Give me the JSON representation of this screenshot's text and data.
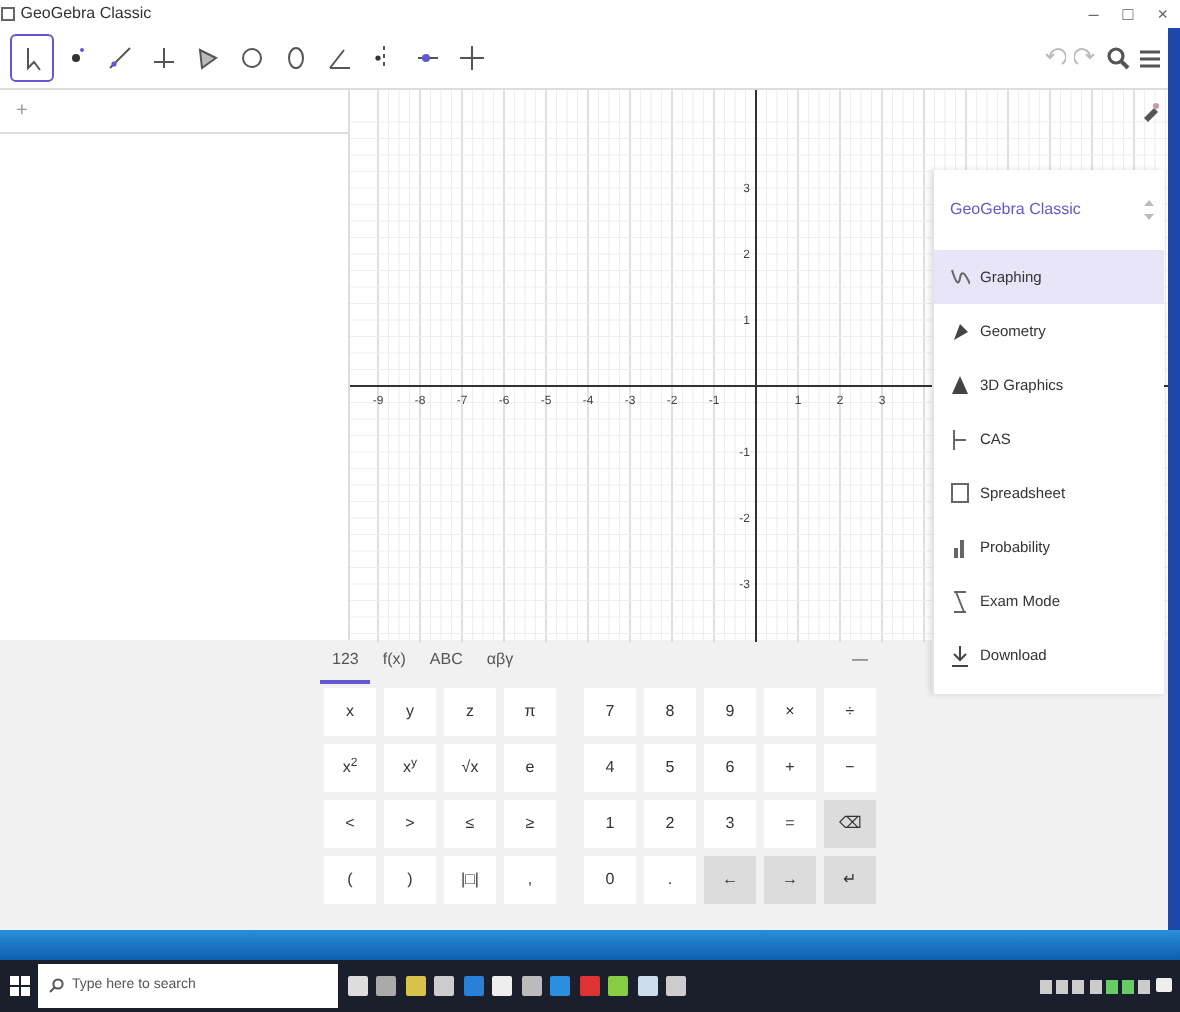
{
  "window": {
    "title": "GeoGebra Classic",
    "controls": [
      "–",
      "□",
      "×"
    ]
  },
  "toolbar": {
    "tools": [
      {
        "selected": true
      },
      {
        "selected": false
      },
      {
        "selected": false
      },
      {
        "selected": false
      },
      {
        "selected": false
      },
      {
        "selected": false
      },
      {
        "selected": false
      },
      {
        "selected": false
      },
      {
        "selected": false
      },
      {
        "selected": false
      },
      {
        "selected": false
      }
    ]
  },
  "algebra": {
    "input_mark": "+"
  },
  "graphics": {
    "x_labels": [
      "-9",
      "-8",
      "-7",
      "-6",
      "-5",
      "-4",
      "-3",
      "-2",
      "-1",
      "1",
      "2",
      "3"
    ],
    "y_labels_above": [
      "3",
      "2",
      "1"
    ],
    "y_labels_below": [
      "-1",
      "-2",
      "-3"
    ]
  },
  "menu": {
    "title": "GeoGebra Classic",
    "items": [
      {
        "label": "Graphing",
        "selected": true
      },
      {
        "label": "Geometry",
        "selected": false
      },
      {
        "label": "3D Graphics",
        "selected": false
      },
      {
        "label": "CAS",
        "selected": false
      },
      {
        "label": "Spreadsheet",
        "selected": false
      },
      {
        "label": "Probability",
        "selected": false
      },
      {
        "label": "Exam Mode",
        "selected": false
      },
      {
        "label": "Download",
        "selected": false
      }
    ]
  },
  "keyboard": {
    "tabs": [
      {
        "label": "123",
        "selected": true
      },
      {
        "label": "f(x)",
        "selected": false
      },
      {
        "label": "ABC",
        "selected": false
      },
      {
        "label": "αβγ",
        "selected": false
      }
    ],
    "close": "—",
    "rows": [
      [
        {
          "label": "x",
          "kind": "key"
        },
        {
          "label": "y",
          "kind": "key"
        },
        {
          "label": "z",
          "kind": "key"
        },
        {
          "label": "π",
          "kind": "key"
        },
        {
          "label": "7",
          "kind": "key"
        },
        {
          "label": "8",
          "kind": "key"
        },
        {
          "label": "9",
          "kind": "key"
        },
        {
          "label": "×",
          "kind": "key"
        },
        {
          "label": "÷",
          "kind": "key"
        }
      ],
      [
        {
          "label": "x$^{2}$",
          "kind": "key"
        },
        {
          "label": "x$^{y}$",
          "kind": "key"
        },
        {
          "label": "√x",
          "kind": "key"
        },
        {
          "label": "e",
          "kind": "key"
        },
        {
          "label": "4",
          "kind": "key"
        },
        {
          "label": "5",
          "kind": "key"
        },
        {
          "label": "6",
          "kind": "key"
        },
        {
          "label": "+",
          "kind": "key"
        },
        {
          "label": "−",
          "kind": "key"
        }
      ],
      [
        {
          "label": "<",
          "kind": "key"
        },
        {
          "label": ">",
          "kind": "key"
        },
        {
          "label": "≤",
          "kind": "key"
        },
        {
          "label": "≥",
          "kind": "key"
        },
        {
          "label": "1",
          "kind": "key"
        },
        {
          "label": "2",
          "kind": "key"
        },
        {
          "label": "3",
          "kind": "key"
        },
        {
          "label": "=",
          "kind": "key"
        },
        {
          "label": "⌫",
          "kind": "action"
        }
      ],
      [
        {
          "label": "(",
          "kind": "key"
        },
        {
          "label": ")",
          "kind": "key"
        },
        {
          "label": "|□|",
          "kind": "key"
        },
        {
          "label": ",",
          "kind": "key"
        },
        {
          "label": "0",
          "kind": "key"
        },
        {
          "label": ".",
          "kind": "key"
        },
        {
          "label": "←",
          "kind": "action"
        },
        {
          "label": "→",
          "kind": "action"
        },
        {
          "label": "↵",
          "kind": "action"
        }
      ]
    ]
  },
  "taskbar": {
    "search": {
      "placeholder": "Type here to search"
    }
  }
}
